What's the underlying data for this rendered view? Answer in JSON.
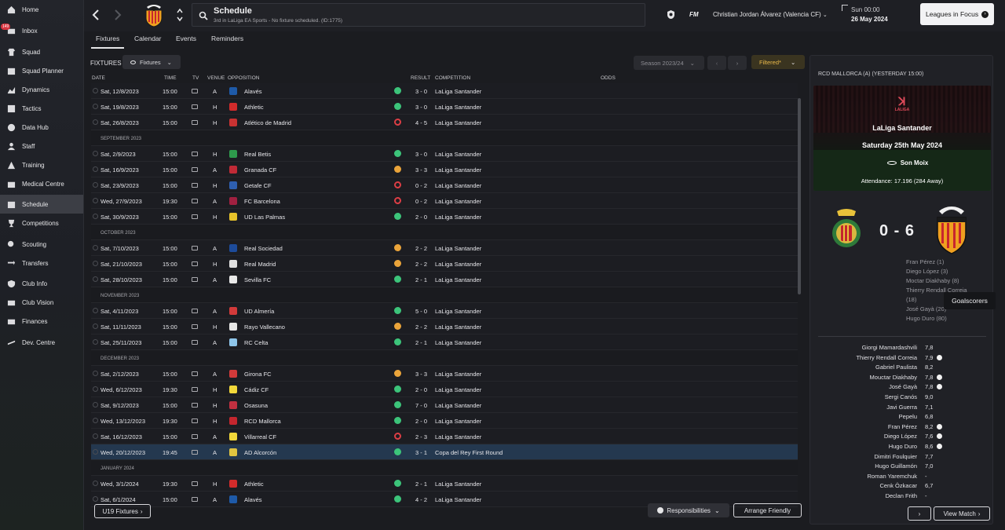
{
  "sidebar": {
    "items": [
      {
        "label": "Home",
        "icon": "home-icon"
      },
      {
        "label": "Inbox",
        "icon": "inbox-icon",
        "badge": "149"
      },
      {
        "label": "Squad",
        "icon": "shirt-icon"
      },
      {
        "label": "Squad Planner",
        "icon": "planner-icon"
      },
      {
        "label": "Dynamics",
        "icon": "dynamics-icon"
      },
      {
        "label": "Tactics",
        "icon": "tactics-icon"
      },
      {
        "label": "Data Hub",
        "icon": "data-hub-icon"
      },
      {
        "label": "Staff",
        "icon": "staff-icon"
      },
      {
        "label": "Training",
        "icon": "training-icon"
      },
      {
        "label": "Medical Centre",
        "icon": "medical-icon"
      },
      {
        "label": "Schedule",
        "icon": "calendar-icon",
        "active": true
      },
      {
        "label": "Competitions",
        "icon": "trophy-icon"
      },
      {
        "label": "Scouting",
        "icon": "scouting-icon"
      },
      {
        "label": "Transfers",
        "icon": "transfers-icon"
      },
      {
        "label": "Club Info",
        "icon": "shield-icon"
      },
      {
        "label": "Club Vision",
        "icon": "vision-icon"
      },
      {
        "label": "Finances",
        "icon": "finances-icon"
      },
      {
        "label": "Dev. Centre",
        "icon": "dev-centre-icon"
      }
    ]
  },
  "header": {
    "title": "Schedule",
    "subtitle": "3rd in LaLiga EA Sports - No fixture scheduled. (ID:1775)",
    "fm_label": "FM",
    "manager": "Christian Jordan Álvarez (Valencia CF)",
    "time": "Sun 00:00",
    "date": "26 May 2024",
    "leagues_button": "Leagues in Focus"
  },
  "tabs": [
    "Fixtures",
    "Calendar",
    "Events",
    "Reminders"
  ],
  "fixtures": {
    "label": "FIXTURES",
    "filter_dropdown": "Fixtures",
    "season": "Season 2023/24",
    "filtered": "Filtered*",
    "columns": {
      "date": "DATE",
      "time": "TIME",
      "tv": "TV",
      "venue": "VENUE",
      "opposition": "OPPOSITION",
      "result": "RESULT",
      "competition": "COMPETITION",
      "odds": "ODDS"
    },
    "rows": [
      {
        "date": "Sat, 12/8/2023",
        "time": "15:00",
        "venue": "A",
        "opp": "Alavés",
        "res": "w",
        "score": "3 - 0",
        "comp": "LaLiga Santander",
        "logo": "#1e5aa8"
      },
      {
        "date": "Sat, 19/8/2023",
        "time": "15:00",
        "venue": "H",
        "opp": "Athletic",
        "res": "w",
        "score": "3 - 0",
        "comp": "LaLiga Santander",
        "logo": "#d22b2b"
      },
      {
        "date": "Sat, 26/8/2023",
        "time": "15:00",
        "venue": "H",
        "opp": "Atlético de Madrid",
        "res": "l",
        "score": "4 - 5",
        "comp": "LaLiga Santander",
        "logo": "#c83232"
      },
      {
        "month": "SEPTEMBER 2023"
      },
      {
        "date": "Sat, 2/9/2023",
        "time": "15:00",
        "venue": "H",
        "opp": "Real Betis",
        "res": "w",
        "score": "3 - 0",
        "comp": "LaLiga Santander",
        "logo": "#2e9a4c"
      },
      {
        "date": "Sat, 16/9/2023",
        "time": "15:00",
        "venue": "A",
        "opp": "Granada CF",
        "res": "d",
        "score": "3 - 3",
        "comp": "LaLiga Santander",
        "logo": "#c02a36"
      },
      {
        "date": "Sat, 23/9/2023",
        "time": "15:00",
        "venue": "H",
        "opp": "Getafe CF",
        "res": "l",
        "score": "0 - 2",
        "comp": "LaLiga Santander",
        "logo": "#2e5fb0"
      },
      {
        "date": "Wed, 27/9/2023",
        "time": "19:30",
        "venue": "A",
        "opp": "FC Barcelona",
        "res": "l",
        "score": "0 - 2",
        "comp": "LaLiga Santander",
        "logo": "#a02040"
      },
      {
        "date": "Sat, 30/9/2023",
        "time": "15:00",
        "venue": "H",
        "opp": "UD Las Palmas",
        "res": "w",
        "score": "2 - 0",
        "comp": "LaLiga Santander",
        "logo": "#e6c22a"
      },
      {
        "month": "OCTOBER 2023"
      },
      {
        "date": "Sat, 7/10/2023",
        "time": "15:00",
        "venue": "A",
        "opp": "Real Sociedad",
        "res": "d",
        "score": "2 - 2",
        "comp": "LaLiga Santander",
        "logo": "#1d4b9a"
      },
      {
        "date": "Sat, 21/10/2023",
        "time": "15:00",
        "venue": "H",
        "opp": "Real Madrid",
        "res": "d",
        "score": "2 - 2",
        "comp": "LaLiga Santander",
        "logo": "#e0e0e0"
      },
      {
        "date": "Sat, 28/10/2023",
        "time": "15:00",
        "venue": "A",
        "opp": "Sevilla FC",
        "res": "w",
        "score": "2 - 1",
        "comp": "LaLiga Santander",
        "logo": "#e8e8e8"
      },
      {
        "month": "NOVEMBER 2023"
      },
      {
        "date": "Sat, 4/11/2023",
        "time": "15:00",
        "venue": "A",
        "opp": "UD Almería",
        "res": "w",
        "score": "5 - 0",
        "comp": "LaLiga Santander",
        "logo": "#d23a3a"
      },
      {
        "date": "Sat, 11/11/2023",
        "time": "15:00",
        "venue": "H",
        "opp": "Rayo Vallecano",
        "res": "d",
        "score": "2 - 2",
        "comp": "LaLiga Santander",
        "logo": "#e6e6e6"
      },
      {
        "date": "Sat, 25/11/2023",
        "time": "15:00",
        "venue": "A",
        "opp": "RC Celta",
        "res": "w",
        "score": "2 - 1",
        "comp": "LaLiga Santander",
        "logo": "#8ec5ea"
      },
      {
        "month": "DECEMBER 2023"
      },
      {
        "date": "Sat, 2/12/2023",
        "time": "15:00",
        "venue": "A",
        "opp": "Girona FC",
        "res": "d",
        "score": "3 - 3",
        "comp": "LaLiga Santander",
        "logo": "#d23a3a"
      },
      {
        "date": "Wed, 6/12/2023",
        "time": "19:30",
        "venue": "H",
        "opp": "Cádiz CF",
        "res": "w",
        "score": "2 - 0",
        "comp": "LaLiga Santander",
        "logo": "#f2d83a"
      },
      {
        "date": "Sat, 9/12/2023",
        "time": "15:00",
        "venue": "H",
        "opp": "Osasuna",
        "res": "w",
        "score": "7 - 0",
        "comp": "LaLiga Santander",
        "logo": "#c23040"
      },
      {
        "date": "Wed, 13/12/2023",
        "time": "19:30",
        "venue": "H",
        "opp": "RCD Mallorca",
        "res": "w",
        "score": "2 - 0",
        "comp": "LaLiga Santander",
        "logo": "#c4262e"
      },
      {
        "date": "Sat, 16/12/2023",
        "time": "15:00",
        "venue": "A",
        "opp": "Villarreal CF",
        "res": "l",
        "score": "2 - 3",
        "comp": "LaLiga Santander",
        "logo": "#f2d83a"
      },
      {
        "date": "Wed, 20/12/2023",
        "time": "19:45",
        "venue": "A",
        "opp": "AD Alcorcón",
        "res": "w",
        "score": "3 - 1",
        "comp": "Copa del Rey First Round",
        "logo": "#e0c440",
        "highlight": true
      },
      {
        "month": "JANUARY 2024"
      },
      {
        "date": "Wed, 3/1/2024",
        "time": "19:30",
        "venue": "H",
        "opp": "Athletic",
        "res": "w",
        "score": "2 - 1",
        "comp": "LaLiga Santander",
        "logo": "#d22b2b"
      },
      {
        "date": "Sat, 6/1/2024",
        "time": "15:00",
        "venue": "A",
        "opp": "Alavés",
        "res": "w",
        "score": "4 - 2",
        "comp": "LaLiga Santander",
        "logo": "#1e5aa8"
      }
    ],
    "u19_button": "U19 Fixtures",
    "responsibilities": "Responsibilities",
    "arrange_friendly": "Arrange Friendly"
  },
  "match_panel": {
    "title": "RCD MALLORCA (A) (YESTERDAY 15:00)",
    "laliga": "LALIGA",
    "competition": "LaLiga Santander",
    "date": "Saturday 25th May 2024",
    "stadium": "Son Moix",
    "attendance": "Attendance: 17.196 (284 Away)",
    "score": "0 - 6",
    "scorers": [
      "Fran Pérez (1)",
      "Diego López (3)",
      "Moctar Diakhaby (8)",
      "Thierry Rendall Correia",
      "(18)",
      "José Gayà (20)",
      "Hugo Duro (80)"
    ],
    "goalscorers_tooltip": "Goalscorers",
    "ratings": [
      {
        "name": "Giorgi Mamardashvili",
        "rating": "7,8",
        "goal": false
      },
      {
        "name": "Thierry Rendall Correia",
        "rating": "7,9",
        "goal": true
      },
      {
        "name": "Gabriel Paulista",
        "rating": "8,2",
        "goal": false
      },
      {
        "name": "Mouctar Diakhaby",
        "rating": "7,8",
        "goal": true
      },
      {
        "name": "José Gayà",
        "rating": "7,8",
        "goal": true
      },
      {
        "name": "Sergi Canós",
        "rating": "9,0",
        "goal": false
      },
      {
        "name": "Javi Guerra",
        "rating": "7,1",
        "goal": false
      },
      {
        "name": "Pepelu",
        "rating": "6,8",
        "goal": false
      },
      {
        "name": "Fran Pérez",
        "rating": "8,2",
        "goal": true
      },
      {
        "name": "Diego López",
        "rating": "7,6",
        "goal": true
      },
      {
        "name": "Hugo Duro",
        "rating": "8,6",
        "goal": true
      },
      {
        "name": "Dimitri Foulquier",
        "rating": "7,7",
        "goal": false
      },
      {
        "name": "Hugo Guillamón",
        "rating": "7,0",
        "goal": false
      },
      {
        "name": "Roman Yaremchuk",
        "rating": "-",
        "goal": false
      },
      {
        "name": "Cenk Özkacar",
        "rating": "6,7",
        "goal": false
      },
      {
        "name": "Declan Frith",
        "rating": "-",
        "goal": false
      }
    ],
    "view_match": "View Match"
  }
}
